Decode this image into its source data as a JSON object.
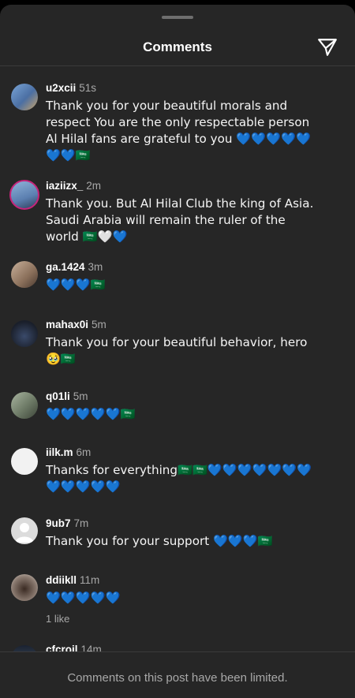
{
  "header": {
    "title": "Comments"
  },
  "comments": [
    {
      "user": "u2xcii",
      "time": "51s",
      "text": "Thank you for your beautiful morals and respect You are the only respectable person Al Hilal fans are grateful to you 💙💙💙💙💙💙💙🇸🇦"
    },
    {
      "user": "iaziizx_",
      "time": "2m",
      "text": "Thank you. But Al Hilal Club the king of Asia. Saudi Arabia will remain the ruler of the world 🇸🇦🤍💙"
    },
    {
      "user": "ga.1424",
      "time": "3m",
      "text": "💙💙💙🇸🇦"
    },
    {
      "user": "mahax0i",
      "time": "5m",
      "text": "Thank you for your beautiful behavior, hero🥹🇸🇦"
    },
    {
      "user": "q01li",
      "time": "5m",
      "text": "💙💙💙💙💙🇸🇦"
    },
    {
      "user": "iilk.m",
      "time": "6m",
      "text": "Thanks for everything🇸🇦🇸🇦💙💙💙💙💙💙💙💙💙💙💙💙"
    },
    {
      "user": "9ub7",
      "time": "7m",
      "text": "Thank you for your support 💙💙💙🇸🇦"
    },
    {
      "user": "ddiikll",
      "time": "11m",
      "text": "💙💙💙💙💙",
      "likes": "1 like"
    },
    {
      "user": "cfcroil",
      "time": "14m"
    }
  ],
  "footer": {
    "notice": "Comments on this post have been limited."
  }
}
